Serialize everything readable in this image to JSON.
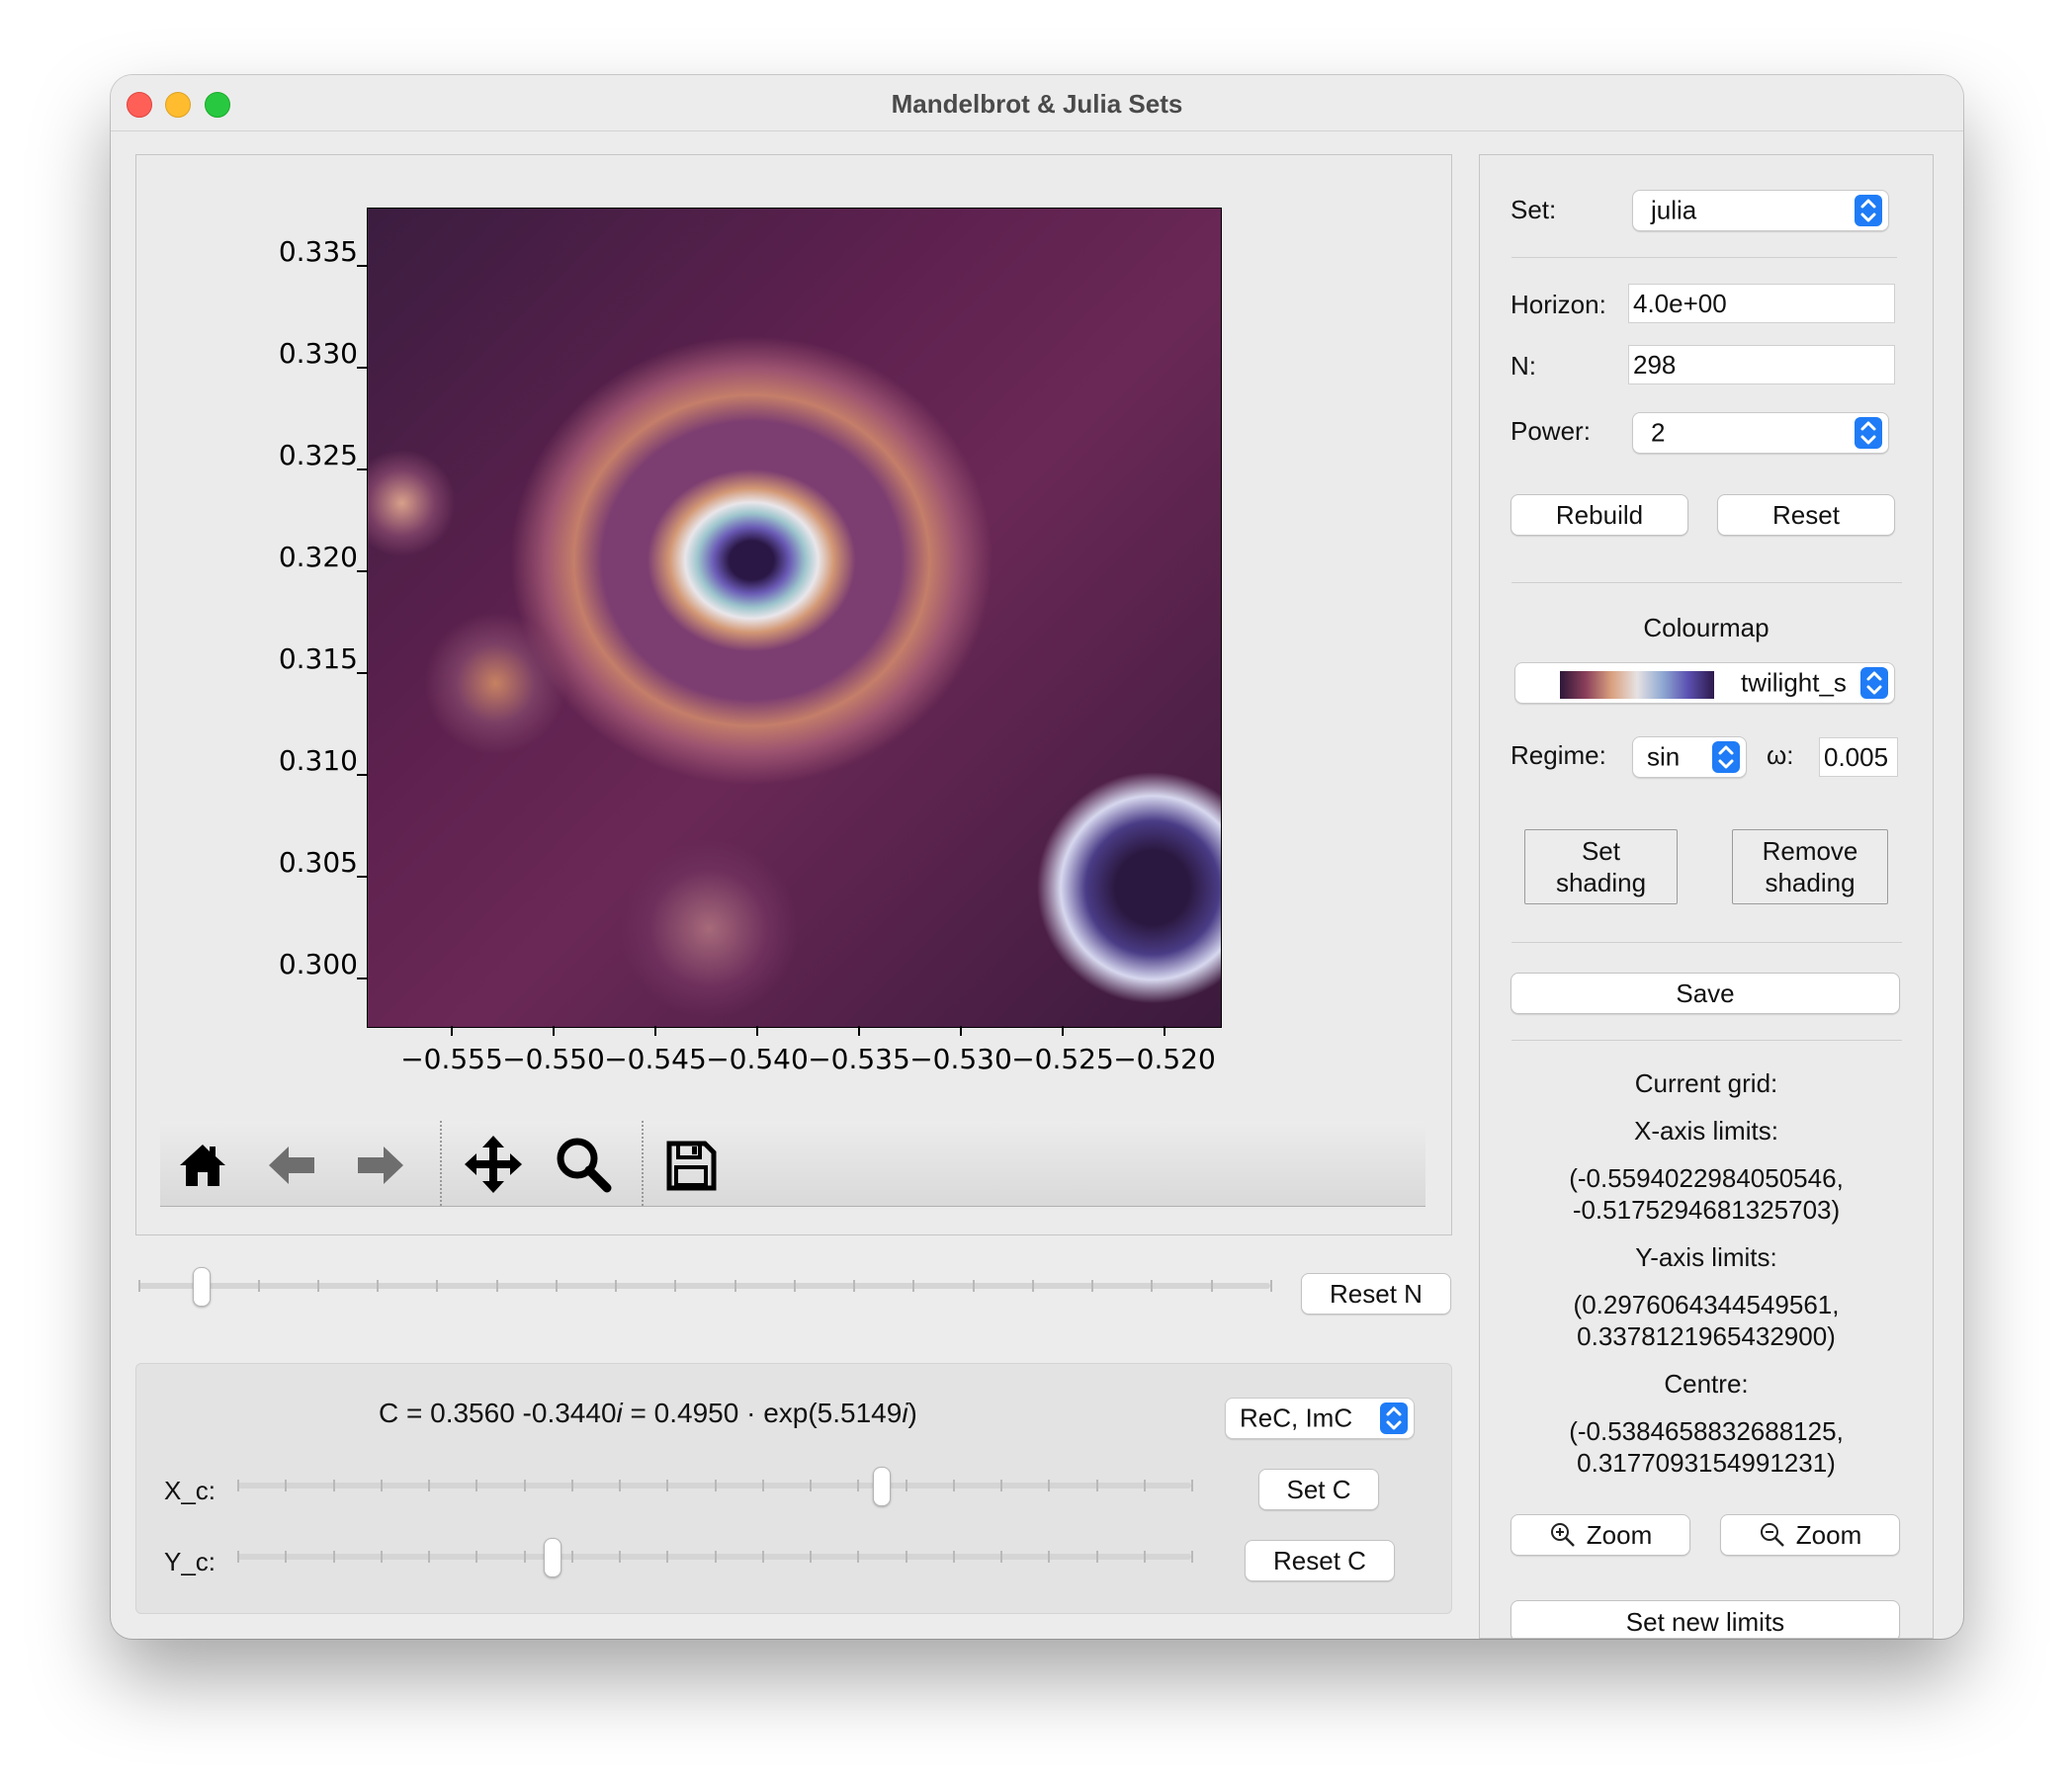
{
  "window": {
    "title": "Mandelbrot & Julia Sets"
  },
  "plot": {
    "y_ticks": [
      "0.335",
      "0.330",
      "0.325",
      "0.320",
      "0.315",
      "0.310",
      "0.305",
      "0.300"
    ],
    "x_ticks": [
      "−0.555",
      "−0.550",
      "−0.545",
      "−0.540",
      "−0.535",
      "−0.530",
      "−0.525",
      "−0.520"
    ]
  },
  "toolbar": {
    "icons": [
      "home-icon",
      "back-arrow-icon",
      "forward-arrow-icon",
      "pan-move-icon",
      "zoom-magnifier-icon",
      "save-floppy-icon"
    ]
  },
  "n_slider": {
    "value_fraction": 0.055,
    "reset_label": "Reset N"
  },
  "c_panel": {
    "c_prefix": "C = 0.3560 -0.3440",
    "c_i1": "i",
    "c_mid": " = 0.4950",
    "c_dot": "·",
    "c_exp": "exp(5.5149",
    "c_i2": "i",
    "c_close": ")",
    "mode_select": "ReC, ImC",
    "xc_label": "X_c:",
    "yc_label": "Y_c:",
    "xc_fraction": 0.675,
    "yc_fraction": 0.33,
    "set_c_label": "Set C",
    "reset_c_label": "Reset C"
  },
  "sidebar": {
    "set_label": "Set:",
    "set_value": "julia",
    "horizon_label": "Horizon:",
    "horizon_value": "4.0e+00",
    "n_label": "N:",
    "n_value": "298",
    "power_label": "Power:",
    "power_value": "2",
    "rebuild_label": "Rebuild",
    "reset_label": "Reset",
    "colourmap_heading": "Colourmap",
    "colourmap_value": "twilight_s",
    "regime_label": "Regime:",
    "regime_value": "sin",
    "omega_label": "ω:",
    "omega_value": "0.005",
    "set_shading_line1": "Set",
    "set_shading_line2": "shading",
    "remove_shading_line1": "Remove",
    "remove_shading_line2": "shading",
    "save_label": "Save",
    "current_grid_label": "Current grid:",
    "x_limits_label": "X-axis limits:",
    "x_limits_line1": "(-0.5594022984050546,",
    "x_limits_line2": "-0.5175294681325703)",
    "y_limits_label": "Y-axis limits:",
    "y_limits_line1": "(0.2976064344549561,",
    "y_limits_line2": "0.3378121965432900)",
    "centre_label": "Centre:",
    "centre_line1": "(-0.5384658832688125,",
    "centre_line2": "0.3177093154991231)",
    "zoom_in_label": "Zoom",
    "zoom_out_label": "Zoom",
    "set_new_limits_label": "Set new limits"
  },
  "colors": {
    "accent": "#1f7cf6",
    "colourmap_gradient": [
      "#2e1739",
      "#8a3f5a",
      "#d9a07e",
      "#e6e1e2",
      "#8fa9d2",
      "#5a4fb0",
      "#2e1a4a"
    ]
  }
}
